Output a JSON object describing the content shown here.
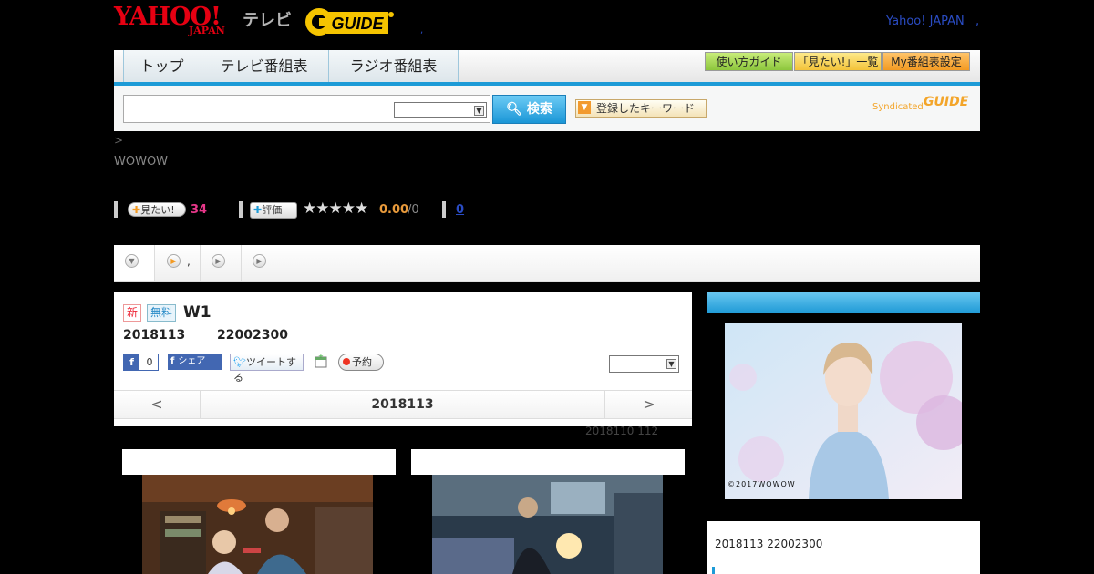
{
  "header": {
    "yahoo_logo": "YAHOO!",
    "japan_logo": "JAPAN",
    "tv_label": "テレビ",
    "gguide_logo": "GUIDE",
    "dot": ",",
    "yahoo_japan_link": "Yahoo! JAPAN",
    "trailing_dot": ","
  },
  "nav": {
    "tabs": [
      "トップ",
      "テレビ番組表",
      "ラジオ番組表"
    ],
    "utility": [
      "使い方ガイド",
      "「見たい!」一覧",
      "My番組表設定"
    ]
  },
  "search": {
    "input_value": "",
    "select_value": "",
    "button_label": "検索",
    "keyword_button": "登録したキーワード",
    "syndicated": "Syndicated",
    "syndicated_logo": "GUIDE"
  },
  "breadcrumb": ">",
  "channel": "WOWOW",
  "stats": {
    "mitai_label": "見たい!",
    "mitai_count": "34",
    "hyouka_label": "評価",
    "stars": "★★★★★",
    "rating": "0.00",
    "rating_of": "/0",
    "reviews_link": "0"
  },
  "tabstrip": {
    "tab2_label": ","
  },
  "program": {
    "badge_new": "新",
    "badge_free": "無料",
    "title": "W1",
    "date": "2018113",
    "time": "22002300",
    "fb_count": "0",
    "share_label": "シェア",
    "tweet_label": "ツイートする",
    "reserve_label": "予約",
    "select_value": "",
    "pager_prev": "<",
    "pager_date": "2018113",
    "pager_next": ">",
    "note": "2018110  112"
  },
  "sidebar": {
    "copyright": "©2017WOWOW",
    "info": "2018113  22002300"
  },
  "colors": {
    "yahoo_red": "#e60012",
    "accent_blue": "#1d9bd7",
    "gguide_yellow": "#f5c400",
    "rating_orange": "#e89a3b",
    "mitai_pink": "#e8378a"
  }
}
